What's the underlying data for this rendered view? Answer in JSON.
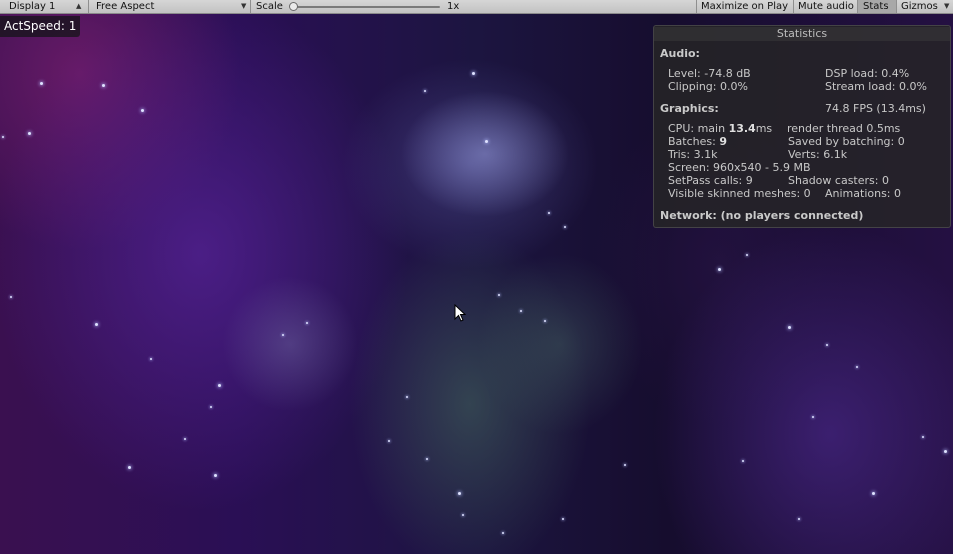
{
  "toolbar": {
    "display_label": "Display 1",
    "aspect_label": "Free Aspect",
    "scale_label": "Scale",
    "scale_value": "1x",
    "maximize_label": "Maximize on Play",
    "mute_label": "Mute audio",
    "stats_label": "Stats",
    "gizmos_label": "Gizmos",
    "stats_active": true
  },
  "game": {
    "actspeed_label": "ActSpeed: 1"
  },
  "stats": {
    "title": "Statistics",
    "audio": {
      "header": "Audio:",
      "level": "Level: -74.8 dB",
      "dsp_load": "DSP load: 0.4%",
      "clipping": "Clipping: 0.0%",
      "stream_load": "Stream load: 0.0%"
    },
    "graphics": {
      "header": "Graphics:",
      "fps": "74.8 FPS (13.4ms)",
      "cpu_prefix": "CPU: main ",
      "cpu_main_value": "13.4",
      "cpu_suffix": "ms",
      "render_thread": "render thread 0.5ms",
      "batches_prefix": "Batches: ",
      "batches_value": "9",
      "saved_by_batching": "Saved by batching: 0",
      "tris": "Tris: 3.1k",
      "verts": "Verts: 6.1k",
      "screen": "Screen: 960x540 - 5.9 MB",
      "setpass": "SetPass calls: 9",
      "shadow_casters": "Shadow casters: 0",
      "skinned_meshes": "Visible skinned meshes: 0",
      "animations": "Animations: 0"
    },
    "network": {
      "header": "Network: (no players connected)"
    }
  },
  "icons": {
    "display_dropdown": "updown-arrows-icon",
    "aspect_dropdown": "down-arrow-icon",
    "gizmos_dropdown": "down-arrow-icon",
    "cursor": "mouse-pointer-icon"
  }
}
